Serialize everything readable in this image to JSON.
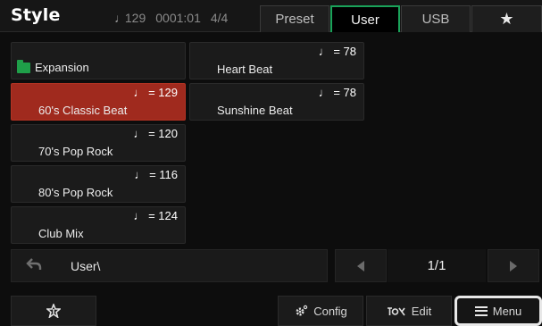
{
  "header": {
    "title": "Style",
    "tempo": "129",
    "tempo_note": "♩",
    "position": "0001:01",
    "time_signature": "4/4",
    "tabs": [
      {
        "label": "Preset",
        "active": false
      },
      {
        "label": "User",
        "active": true
      },
      {
        "label": "USB",
        "active": false
      }
    ],
    "favorite_tab_icon": "star-icon"
  },
  "styles": [
    {
      "name": "Expansion",
      "type": "folder",
      "tempo": ""
    },
    {
      "name": "60's Classic Beat",
      "type": "style",
      "tempo": "♩ = 129",
      "selected": true
    },
    {
      "name": "70's Pop Rock",
      "type": "style",
      "tempo": "♩ = 120"
    },
    {
      "name": "80's Pop Rock",
      "type": "style",
      "tempo": "♩ = 116"
    },
    {
      "name": "Club Mix",
      "type": "style",
      "tempo": "♩ = 124"
    },
    {
      "name": "Heart Beat",
      "type": "style",
      "tempo": "♩ = 78"
    },
    {
      "name": "Sunshine Beat",
      "type": "style",
      "tempo": "♩ = 78"
    }
  ],
  "pathbar": {
    "path": "User\\",
    "page": "1/1"
  },
  "bottom": {
    "favorite_icon": "star-outline-icon",
    "config_label": "Config",
    "edit_label": "Edit",
    "menu_label": "Menu"
  },
  "colors": {
    "accent_green": "#1aa35a",
    "selected_red": "#a02a1e",
    "folder_green": "#1f9f49"
  }
}
